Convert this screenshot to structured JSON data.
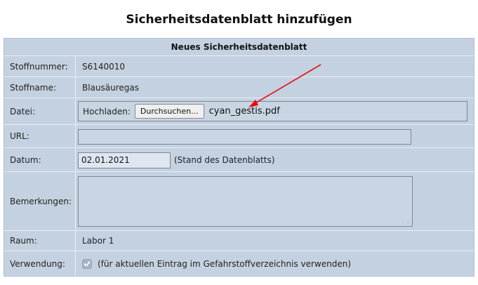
{
  "page": {
    "title": "Sicherheitsdatenblatt hinzufügen"
  },
  "form": {
    "header": "Neues Sicherheitsdatenblatt",
    "stoffnummer": {
      "label": "Stoffnummer:",
      "value": "S6140010"
    },
    "stoffname": {
      "label": "Stoffname:",
      "value": "Blausäuregas"
    },
    "datei": {
      "label": "Datei:",
      "upload_label": "Hochladen:",
      "browse_button": "Durchsuchen...",
      "file_name": "cyan_gestis.pdf"
    },
    "url": {
      "label": "URL:",
      "value": ""
    },
    "datum": {
      "label": "Datum:",
      "value": "02.01.2021",
      "note": "(Stand des Datenblatts)"
    },
    "bemerkungen": {
      "label": "Bemerkungen:",
      "value": ""
    },
    "raum": {
      "label": "Raum:",
      "value": "Labor 1"
    },
    "verwendung": {
      "label": "Verwendung:",
      "checked": true,
      "text": "(für aktuellen Eintrag im Gefahrstoffverzeichnis verwenden)"
    }
  },
  "colors": {
    "panel_background": "#c4d1e0",
    "row_divider": "#e8eef5",
    "annotation_arrow": "#e01010"
  },
  "icons": {
    "annotation": "red-arrow-icon",
    "checkbox": "checkmark-icon"
  }
}
